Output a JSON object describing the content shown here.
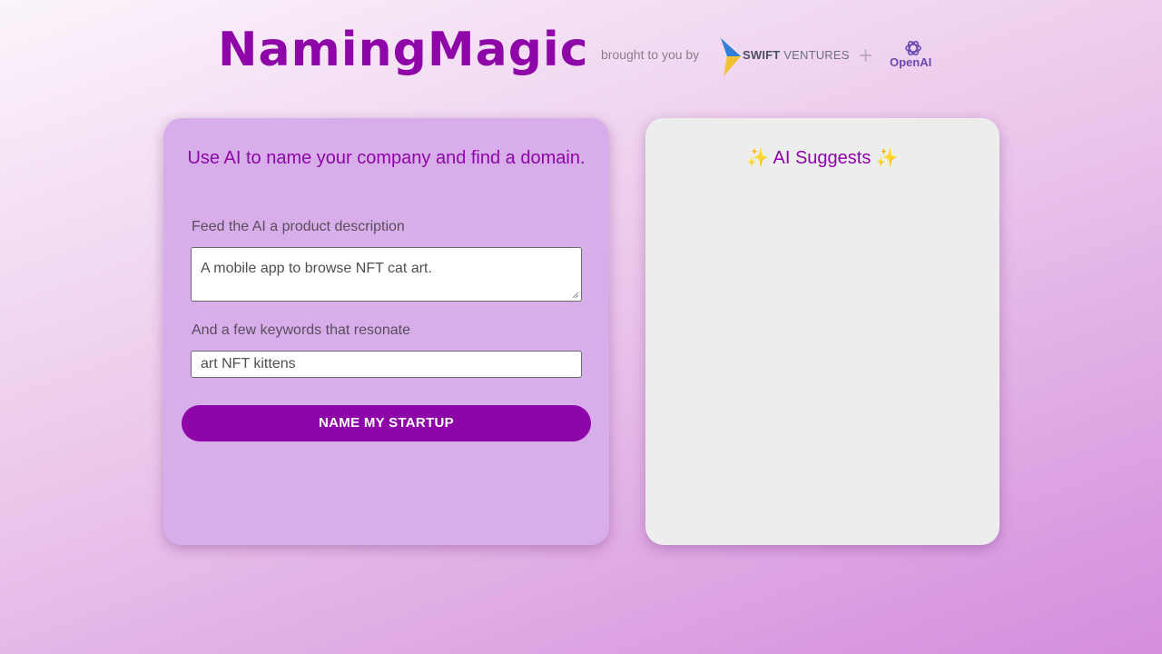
{
  "header": {
    "app_title": "NamingMagic",
    "brought_by": "brought to you by",
    "partner_swift_strong": "SWIFT",
    "partner_swift_rest": "VENTURES",
    "plus": "+",
    "partner_openai": "OpenAI"
  },
  "form": {
    "tagline": "Use AI to name your company and find a domain.",
    "description_label": "Feed the AI a product description",
    "description_value": "A mobile app to browse NFT cat art.",
    "keywords_label": "And a few keywords that resonate",
    "keywords_value": "art NFT kittens",
    "submit_label": "NAME MY STARTUP"
  },
  "results": {
    "sparkle_left": "✨",
    "title": "AI Suggests",
    "sparkle_right": "✨"
  },
  "colors": {
    "brand": "#8e05a8",
    "left_panel_bg": "#d8aeea",
    "right_panel_bg": "#eeeded"
  }
}
